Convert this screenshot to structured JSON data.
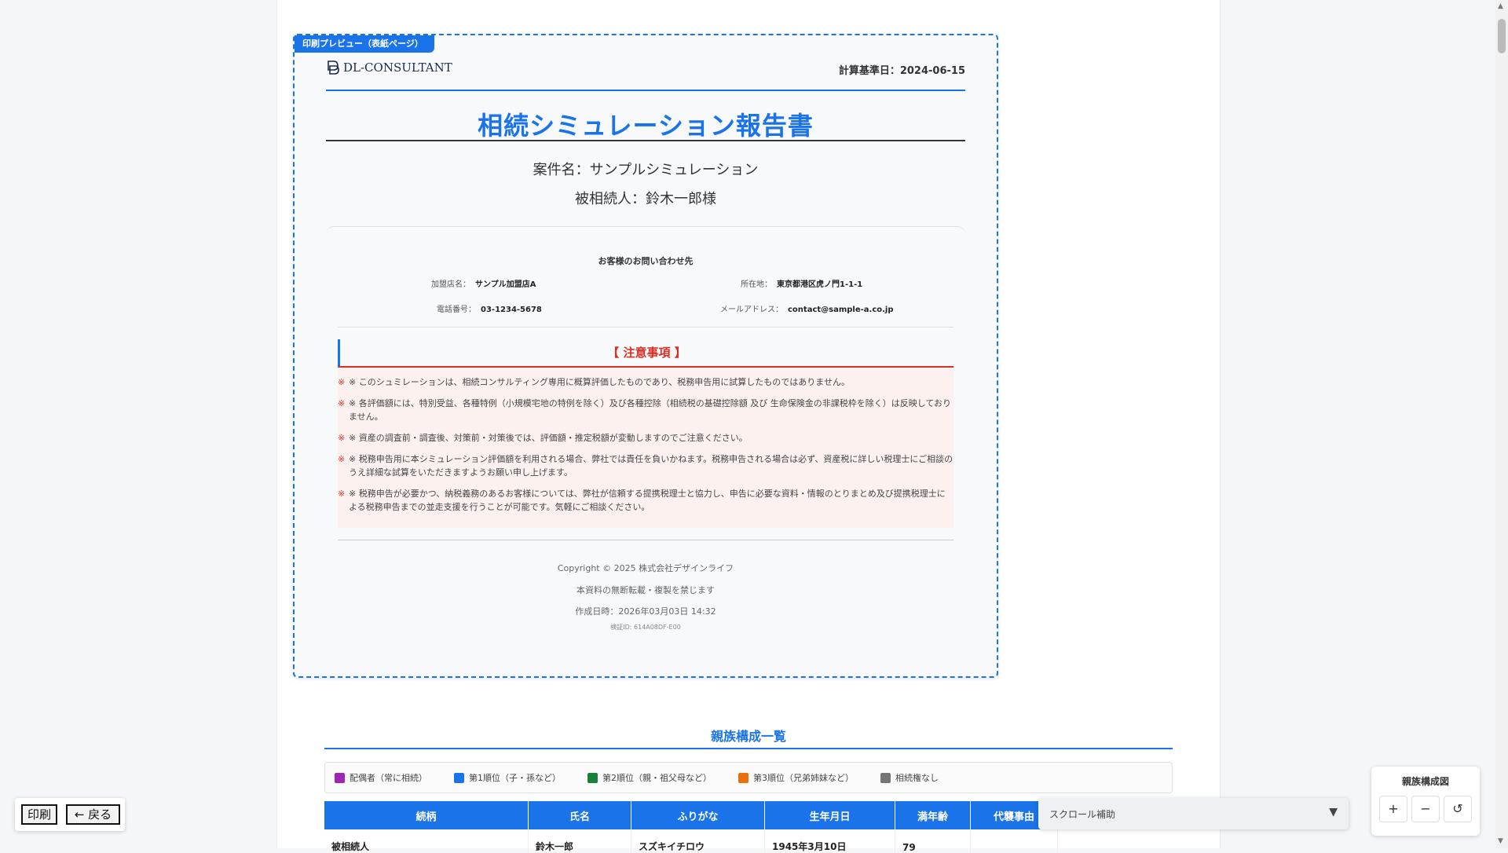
{
  "preview": {
    "tag": "印刷プレビュー（表紙ページ）",
    "logo_text": "DL-CONSULTANT",
    "base_date": "計算基準日：2024-06-15",
    "title": "相続シミュレーション報告書",
    "case_name": "案件名：サンプルシミュレーション",
    "decedent": "被相続人：鈴木一郎様",
    "contact": {
      "title": "お客様のお問い合わせ先",
      "shop_label": "加盟店名：",
      "shop_value": "サンプル加盟店A",
      "address_label": "所在地：",
      "address_value": "東京都港区虎ノ門1-1-1",
      "phone_label": "電話番号：",
      "phone_value": "03-1234-5678",
      "email_label": "メールアドレス：",
      "email_value": "contact@sample-a.co.jp"
    },
    "notice": {
      "title": "【 注意事項 】",
      "mark": "※",
      "items": [
        "※ このシュミレーションは、相続コンサルティング専用に概算評価したものであり、税務申告用に試算したものではありません。",
        "※ 各評価額には、特別受益、各種特例（小規模宅地の特例を除く）及び各種控除（相続税の基礎控除額 及び 生命保険金の非課税枠を除く）は反映しておりません。",
        "※ 資産の調査前・調査後、対策前・対策後では、評価額・推定税額が変動しますのでご注意ください。",
        "※ 税務申告用に本シミュレーション評価額を利用される場合、弊社では責任を負いかねます。税務申告される場合は必ず、資産税に詳しい税理士にご相談のうえ詳細な試算をいただきますようお願い申し上げます。",
        "※ 税務申告が必要かつ、納税義務のあるお客様については、弊社が信頼する提携税理士と協力し、申告に必要な資料・情報のとりまとめ及び提携税理士による税務申告までの並走支援を行うことが可能です。気軽にご相談ください。"
      ]
    },
    "footer": {
      "copyright": "Copyright © 2025 株式会社デザインライフ",
      "no_copy": "本資料の無断転載・複製を禁じます",
      "created": "作成日時：2026年03月03日 14:32",
      "verify_id": "検証ID: 614A08DF-E00"
    }
  },
  "family": {
    "section_title": "親族構成一覧",
    "legend": [
      {
        "label": "配偶者（常に相続）",
        "color": "#9c27b0"
      },
      {
        "label": "第1順位（子・孫など）",
        "color": "#1a73e8"
      },
      {
        "label": "第2順位（親・祖父母など）",
        "color": "#188038"
      },
      {
        "label": "第3順位（兄弟姉妹など）",
        "color": "#e8710a"
      },
      {
        "label": "相続権なし",
        "color": "#757575"
      }
    ],
    "columns": [
      "続柄",
      "氏名",
      "ふりがな",
      "生年月日",
      "満年齢",
      "代襲事由"
    ],
    "rows": [
      [
        "被相続人",
        "鈴木一郎",
        "スズキイチロウ",
        "1945年3月10日",
        "79",
        ""
      ]
    ]
  },
  "controls": {
    "print": "印刷",
    "back": "← 戻る",
    "scroll_assist": "スクロール補助",
    "scroll_caret": "▼",
    "family_panel_title": "親族構成図",
    "zoom_in": "+",
    "zoom_out": "−",
    "reset": "↺"
  }
}
